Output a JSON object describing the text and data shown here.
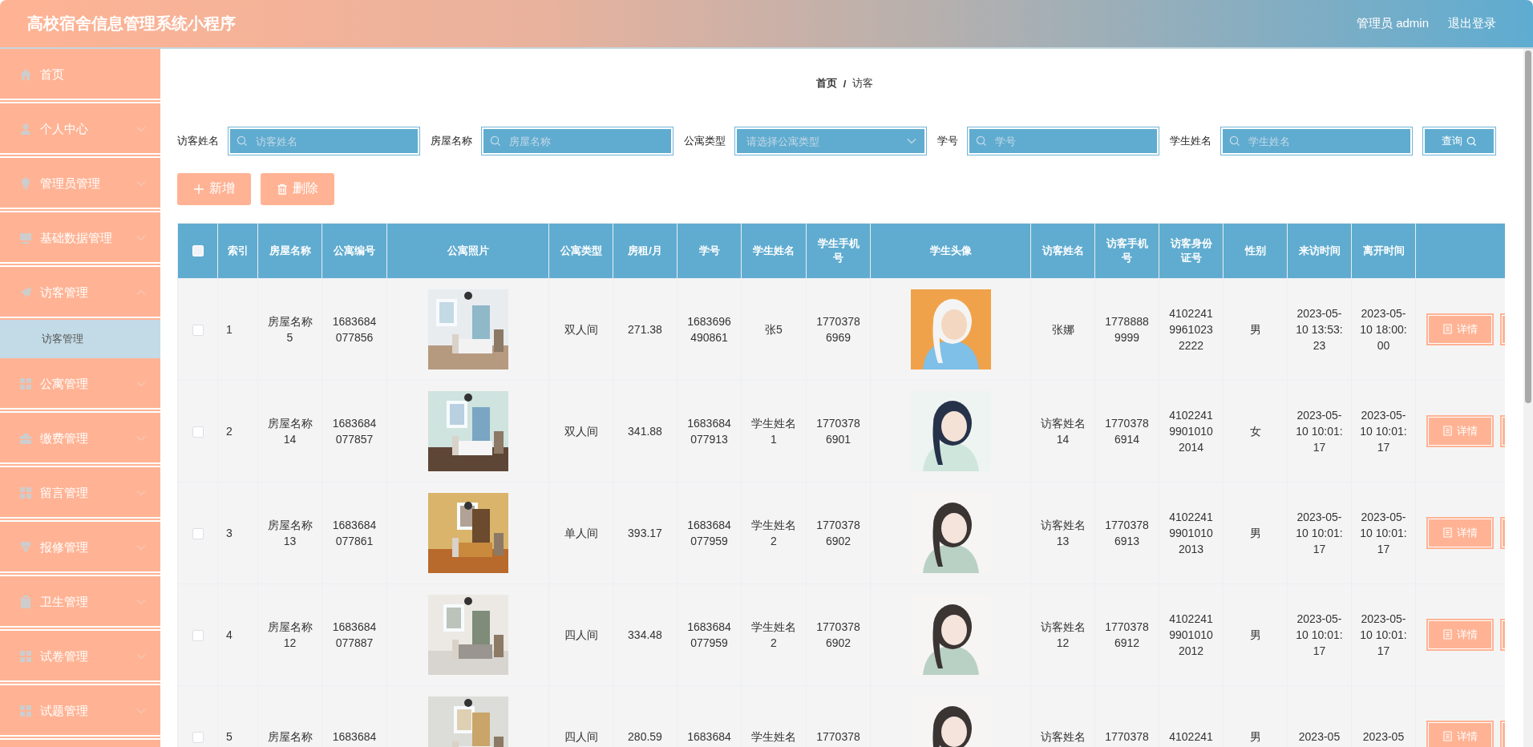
{
  "header": {
    "title": "高校宿舍信息管理系统小程序",
    "user": "管理员 admin",
    "logout": "退出登录"
  },
  "sidebar": {
    "items": [
      {
        "label": "首页",
        "kind": "link"
      },
      {
        "label": "个人中心",
        "kind": "menu",
        "expanded": false
      },
      {
        "label": "管理员管理",
        "kind": "menu",
        "expanded": false
      },
      {
        "label": "基础数据管理",
        "kind": "menu",
        "expanded": false
      },
      {
        "label": "访客管理",
        "kind": "menu",
        "expanded": true,
        "children": [
          {
            "label": "访客管理",
            "selected": true
          }
        ]
      },
      {
        "label": "公寓管理",
        "kind": "menu",
        "expanded": false
      },
      {
        "label": "缴费管理",
        "kind": "menu",
        "expanded": false
      },
      {
        "label": "留言管理",
        "kind": "menu",
        "expanded": false
      },
      {
        "label": "报修管理",
        "kind": "menu",
        "expanded": false
      },
      {
        "label": "卫生管理",
        "kind": "menu",
        "expanded": false
      },
      {
        "label": "试卷管理",
        "kind": "menu",
        "expanded": false
      },
      {
        "label": "试题管理",
        "kind": "menu",
        "expanded": false
      }
    ]
  },
  "breadcrumb": {
    "items": [
      "首页",
      "访客"
    ],
    "separator": "/"
  },
  "search": {
    "fields": [
      {
        "label": "访客姓名",
        "kind": "search",
        "placeholder": "访客姓名"
      },
      {
        "label": "房屋名称",
        "kind": "search",
        "placeholder": "房屋名称"
      },
      {
        "label": "公寓类型",
        "kind": "select",
        "placeholder": "请选择公寓类型"
      },
      {
        "label": "学号",
        "kind": "search",
        "placeholder": "学号"
      },
      {
        "label": "学生姓名",
        "kind": "search",
        "placeholder": "学生姓名"
      }
    ],
    "button": "查询"
  },
  "actions": [
    {
      "label": "新增",
      "kind": "add"
    },
    {
      "label": "删除",
      "kind": "delete"
    }
  ],
  "table": {
    "all_checked": false,
    "columns": [
      "索引",
      "房屋名称",
      "公寓编号",
      "公寓照片",
      "公寓类型",
      "房租/月",
      "学号",
      "学生姓名",
      "学生手机号",
      "学生头像",
      "访客姓名",
      "访客手机号",
      "访客身份证号",
      "性别",
      "来访时间",
      "离开时间"
    ],
    "rows": [
      {
        "selected": false,
        "index": "1",
        "house_name": "房屋名称5",
        "apartment_no": "1683684077856",
        "apartment_type": "双人间",
        "rent": "271.38",
        "student_no": "1683696490861",
        "student_name": "张5",
        "student_phone": "17703786969",
        "visitor_name": "张娜",
        "visitor_phone": "17788889999",
        "visitor_id": "410224199610232222",
        "gender": "男",
        "visit_time": "2023-05-10 13:53:23",
        "leave_time": "2023-05-10 18:00:00",
        "action": "详情"
      },
      {
        "selected": false,
        "index": "2",
        "house_name": "房屋名称14",
        "apartment_no": "1683684077857",
        "apartment_type": "双人间",
        "rent": "341.88",
        "student_no": "1683684077913",
        "student_name": "学生姓名1",
        "student_phone": "17703786901",
        "visitor_name": "访客姓名14",
        "visitor_phone": "17703786914",
        "visitor_id": "410224199010102014",
        "gender": "女",
        "visit_time": "2023-05-10 10:01:17",
        "leave_time": "2023-05-10 10:01:17",
        "action": "详情"
      },
      {
        "selected": false,
        "index": "3",
        "house_name": "房屋名称13",
        "apartment_no": "1683684077861",
        "apartment_type": "单人间",
        "rent": "393.17",
        "student_no": "1683684077959",
        "student_name": "学生姓名2",
        "student_phone": "17703786902",
        "visitor_name": "访客姓名13",
        "visitor_phone": "17703786913",
        "visitor_id": "410224199010102013",
        "gender": "男",
        "visit_time": "2023-05-10 10:01:17",
        "leave_time": "2023-05-10 10:01:17",
        "action": "详情"
      },
      {
        "selected": false,
        "index": "4",
        "house_name": "房屋名称12",
        "apartment_no": "1683684077887",
        "apartment_type": "四人间",
        "rent": "334.48",
        "student_no": "1683684077959",
        "student_name": "学生姓名2",
        "student_phone": "17703786902",
        "visitor_name": "访客姓名12",
        "visitor_phone": "17703786912",
        "visitor_id": "410224199010102012",
        "gender": "男",
        "visit_time": "2023-05-10 10:01:17",
        "leave_time": "2023-05-10 10:01:17",
        "action": "详情"
      },
      {
        "selected": false,
        "index": "5",
        "house_name": "房屋名称",
        "apartment_no": "1683684",
        "apartment_type": "四人间",
        "rent": "280.59",
        "student_no": "1683684",
        "student_name": "学生姓名",
        "student_phone": "1770378",
        "visitor_name": "访客姓名",
        "visitor_phone": "1770378",
        "visitor_id": "4102241",
        "gender": "男",
        "visit_time": "2023-05",
        "leave_time": "2023-05",
        "action": "详情"
      }
    ]
  }
}
